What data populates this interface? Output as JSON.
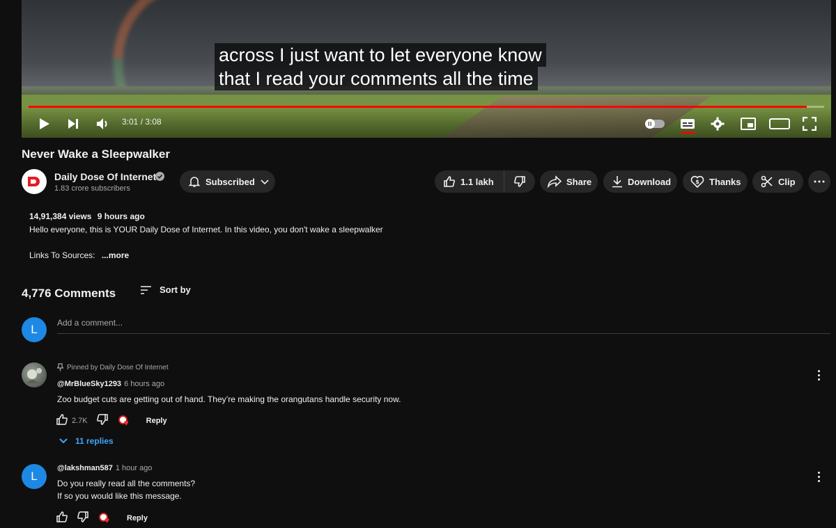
{
  "player": {
    "caption_line1": "across I just want to let everyone know",
    "caption_line2": "that I read your comments all the time",
    "time": "3:01 / 3:08",
    "progress_fraction": 0.978,
    "accent_color": "#ff0000"
  },
  "video": {
    "title": "Never Wake a Sleepwalker",
    "channel_name": "Daily Dose Of Internet",
    "subscribers": "1.83 crore subscribers",
    "subscribe_label": "Subscribed",
    "likes": "1.1 lakh",
    "share_label": "Share",
    "download_label": "Download",
    "thanks_label": "Thanks",
    "clip_label": "Clip"
  },
  "description": {
    "views": "14,91,384 views",
    "ago": "9 hours ago",
    "text": "Hello everyone, this is YOUR Daily Dose of Internet. In this video, you don't wake a sleepwalker",
    "links_label": "Links To Sources:",
    "more_label": "...more"
  },
  "comments": {
    "count_label": "4,776 Comments",
    "sort_label": "Sort by",
    "add_placeholder": "Add a comment...",
    "user_initial": "L",
    "items": [
      {
        "pinned_label": "Pinned by Daily Dose Of Internet",
        "author": "@MrBlueSky1293",
        "ago": "6 hours ago",
        "text": "Zoo budget cuts are getting out of hand. They’re making the orangutans handle security now.",
        "likes": "2.7K",
        "reply_label": "Reply",
        "replies_label": "11 replies"
      },
      {
        "avatar_initial": "L",
        "author": "@lakshman587",
        "ago": "1 hour ago",
        "text_line1": "Do you really read all the comments?",
        "text_line2": "If so you would like this message.",
        "reply_label": "Reply"
      }
    ]
  },
  "icons": [
    "play-icon",
    "next-icon",
    "volume-icon",
    "autoplay-toggle-icon",
    "subtitles-icon",
    "settings-icon",
    "miniplayer-icon",
    "theater-icon",
    "fullscreen-icon",
    "bell-icon",
    "chevron-down-icon",
    "thumbs-up-icon",
    "thumbs-down-icon",
    "share-icon",
    "download-icon",
    "thanks-icon",
    "clip-icon",
    "more-icon",
    "sort-icon",
    "pin-icon",
    "creator-heart-icon"
  ]
}
